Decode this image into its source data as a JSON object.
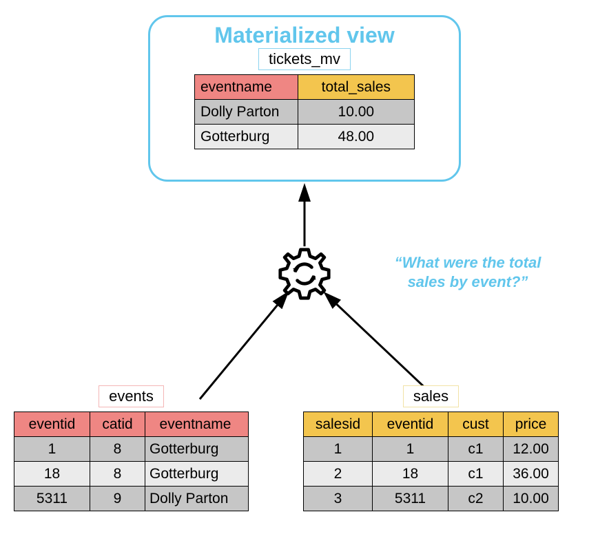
{
  "mv": {
    "title": "Materialized view",
    "label": "tickets_mv",
    "headers": {
      "eventname": "eventname",
      "total_sales": "total_sales"
    },
    "rows": [
      {
        "eventname": "Dolly Parton",
        "total_sales": "10.00"
      },
      {
        "eventname": "Gotterburg",
        "total_sales": "48.00"
      }
    ]
  },
  "quote": "“What were the total sales by event?”",
  "events": {
    "label": "events",
    "headers": {
      "eventid": "eventid",
      "catid": "catid",
      "eventname": "eventname"
    },
    "rows": [
      {
        "eventid": "1",
        "catid": "8",
        "eventname": "Gotterburg"
      },
      {
        "eventid": "18",
        "catid": "8",
        "eventname": "Gotterburg"
      },
      {
        "eventid": "5311",
        "catid": "9",
        "eventname": "Dolly Parton"
      }
    ]
  },
  "sales": {
    "label": "sales",
    "headers": {
      "salesid": "salesid",
      "eventid": "eventid",
      "cust": "cust",
      "price": "price"
    },
    "rows": [
      {
        "salesid": "1",
        "eventid": "1",
        "cust": "c1",
        "price": "12.00"
      },
      {
        "salesid": "2",
        "eventid": "18",
        "cust": "c1",
        "price": "36.00"
      },
      {
        "salesid": "3",
        "eventid": "5311",
        "cust": "c2",
        "price": "10.00"
      }
    ]
  }
}
